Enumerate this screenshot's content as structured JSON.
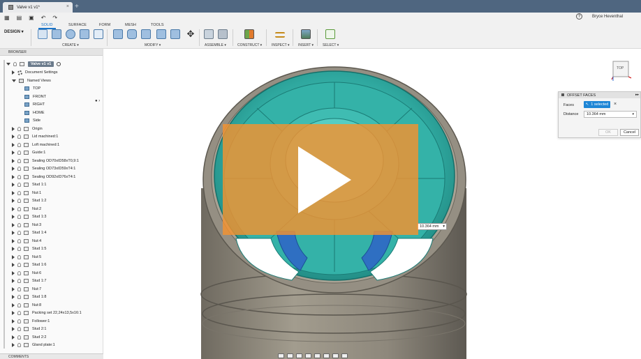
{
  "window": {
    "tab_title": "Valve v1 v1*",
    "user_name": "Bryce Heventhal",
    "help_glyph": "?"
  },
  "toolbar": {
    "workspace_label": "DESIGN ▾",
    "tabs": [
      {
        "label": "SOLID",
        "active": true
      },
      {
        "label": "SURFACE",
        "active": false
      },
      {
        "label": "FORM",
        "active": false
      },
      {
        "label": "MESH",
        "active": false
      },
      {
        "label": "TOOLS",
        "active": false
      }
    ],
    "groups": [
      {
        "label": "CREATE ▾"
      },
      {
        "label": "MODIFY ▾"
      },
      {
        "label": "ASSEMBLE ▾"
      },
      {
        "label": "CONSTRUCT ▾"
      },
      {
        "label": "INSPECT ▾"
      },
      {
        "label": "INSERT ▾"
      },
      {
        "label": "SELECT ▾"
      }
    ]
  },
  "browser": {
    "title": "BROWSER",
    "root": "Valve v1 v1",
    "items": [
      {
        "label": "Document Settings",
        "kind": "settings"
      },
      {
        "label": "Named Views",
        "kind": "folder"
      },
      {
        "label": "TOP",
        "kind": "view"
      },
      {
        "label": "FRONT",
        "kind": "view"
      },
      {
        "label": "RIGHT",
        "kind": "view"
      },
      {
        "label": "HOME",
        "kind": "view"
      },
      {
        "label": "Side",
        "kind": "view"
      },
      {
        "label": "Origin",
        "kind": "comp"
      },
      {
        "label": "Lid machined:1",
        "kind": "comp"
      },
      {
        "label": "Loft machined:1",
        "kind": "comp"
      },
      {
        "label": "Guide:1",
        "kind": "comp"
      },
      {
        "label": "Sealing OD70xID58xT0,9:1",
        "kind": "comp"
      },
      {
        "label": "Sealing OD73xID59xT4:1",
        "kind": "comp"
      },
      {
        "label": "Sealing OD92xID76xT4:1",
        "kind": "comp"
      },
      {
        "label": "Stud 1:1",
        "kind": "comp"
      },
      {
        "label": "Nut:1",
        "kind": "comp"
      },
      {
        "label": "Stud 1:2",
        "kind": "comp"
      },
      {
        "label": "Nut:2",
        "kind": "comp"
      },
      {
        "label": "Stud 1:3",
        "kind": "comp"
      },
      {
        "label": "Nut:3",
        "kind": "comp"
      },
      {
        "label": "Stud 1:4",
        "kind": "comp"
      },
      {
        "label": "Nut:4",
        "kind": "comp"
      },
      {
        "label": "Stud 1:5",
        "kind": "comp"
      },
      {
        "label": "Nut:5",
        "kind": "comp"
      },
      {
        "label": "Stud 1:6",
        "kind": "comp"
      },
      {
        "label": "Nut:6",
        "kind": "comp"
      },
      {
        "label": "Stud 1:7",
        "kind": "comp"
      },
      {
        "label": "Nut:7",
        "kind": "comp"
      },
      {
        "label": "Stud 1:8",
        "kind": "comp"
      },
      {
        "label": "Nut:8",
        "kind": "comp"
      },
      {
        "label": "Packing set 22,24x13,5x16:1",
        "kind": "comp"
      },
      {
        "label": "Follower:1",
        "kind": "comp"
      },
      {
        "label": "Stud 2:1",
        "kind": "comp"
      },
      {
        "label": "Stud 2:2",
        "kind": "comp"
      },
      {
        "label": "Gland plate:1",
        "kind": "comp"
      }
    ]
  },
  "comments": {
    "title": "COMMENTS"
  },
  "dialog": {
    "title": "OFFSET FACES",
    "faces_label": "Faces",
    "faces_value": "1 selected",
    "distance_label": "Distance",
    "distance_value": "10.364 mm",
    "ok_label": "OK",
    "cancel_label": "Cancel"
  },
  "viewport": {
    "dimension_label": "10.364 mm",
    "viewcube_label": "TOP"
  },
  "colors": {
    "tab_strip": "#4f6680",
    "accent": "#1a74c8",
    "part_teal": "#3ab5ad",
    "part_gray": "#8c877b",
    "selected_face": "#2f6fc2",
    "play_overlay": "#f49230"
  }
}
